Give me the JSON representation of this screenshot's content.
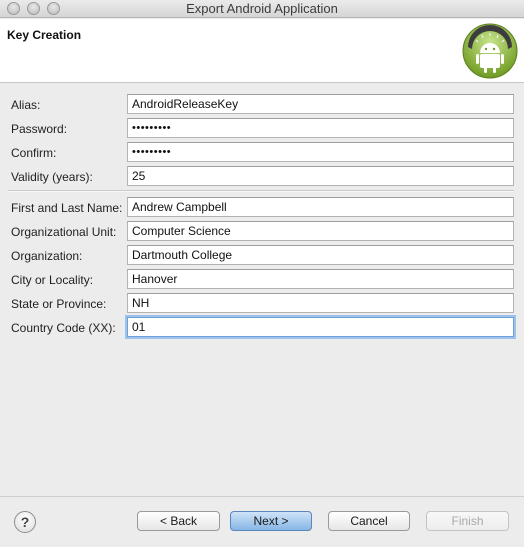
{
  "window": {
    "title": "Export Android Application"
  },
  "banner": {
    "title": "Key Creation",
    "logo_icon": "android-robot-icon"
  },
  "fields": {
    "alias": {
      "label": "Alias:",
      "value": "AndroidReleaseKey"
    },
    "password": {
      "label": "Password:",
      "value": "•••••••••"
    },
    "confirm": {
      "label": "Confirm:",
      "value": "•••••••••"
    },
    "validity": {
      "label": "Validity (years):",
      "value": "25"
    },
    "name": {
      "label": "First and Last Name:",
      "value": "Andrew Campbell"
    },
    "unit": {
      "label": "Organizational Unit:",
      "value": "Computer Science"
    },
    "organization": {
      "label": "Organization:",
      "value": "Dartmouth College"
    },
    "city": {
      "label": "City or Locality:",
      "value": "Hanover"
    },
    "state": {
      "label": "State or Province:",
      "value": "NH"
    },
    "country": {
      "label": "Country Code (XX):",
      "value": "01"
    }
  },
  "buttons": {
    "help": "?",
    "back": "< Back",
    "next": "Next >",
    "cancel": "Cancel",
    "finish": "Finish"
  },
  "colors": {
    "accent": "#87b6e6",
    "android_green": "#9ccd3a",
    "focus_ring": "#9cc2ee"
  }
}
